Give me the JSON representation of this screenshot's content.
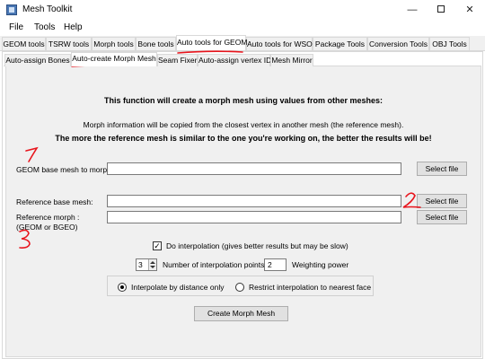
{
  "window": {
    "title": "Mesh Toolkit",
    "app_icon": "app-icon"
  },
  "menu": [
    "File",
    "Tools",
    "Help"
  ],
  "top_tabs": [
    "GEOM tools",
    "TSRW tools",
    "Morph tools",
    "Bone tools",
    "Auto tools for GEOM",
    "Auto tools for WSO",
    "Package Tools",
    "Conversion Tools",
    "OBJ Tools"
  ],
  "top_tab_active": "Auto tools for GEOM",
  "sub_tabs": [
    "Auto-assign Bones",
    "Auto-create Morph Mesh",
    "Seam Fixer",
    "Auto-assign vertex ID",
    "Mesh Mirror"
  ],
  "sub_tab_active": "Auto-create Morph Mesh",
  "content": {
    "heading": "This function will create a morph mesh using values from other meshes:",
    "info": "Morph information will be copied from the closest vertex in another mesh (the reference mesh).",
    "note": "The more the reference mesh is similar to the one you're working on, the better the results will be!",
    "geom_base_label": "GEOM base mesh to morph:",
    "geom_base_value": "",
    "ref_base_label": "Reference base mesh:",
    "ref_base_value": "",
    "ref_morph_label_1": "Reference morph :",
    "ref_morph_label_2": "(GEOM or BGEO)",
    "ref_morph_value": "",
    "select_file": "Select file",
    "interp_label": "Do interpolation (gives better results but may be slow)",
    "interp_checked": true,
    "interp_points_value": "3",
    "interp_points_label": "Number of interpolation points",
    "weighting_value": "2",
    "weighting_label": "Weighting power",
    "radio_distance": "Interpolate by distance only",
    "radio_nearest": "Restrict interpolation to nearest face",
    "radio_selected": "distance",
    "create_button": "Create Morph Mesh"
  },
  "annotations": {
    "num1": "1",
    "num2": "2",
    "num3": "3",
    "color": "#e8141c"
  }
}
